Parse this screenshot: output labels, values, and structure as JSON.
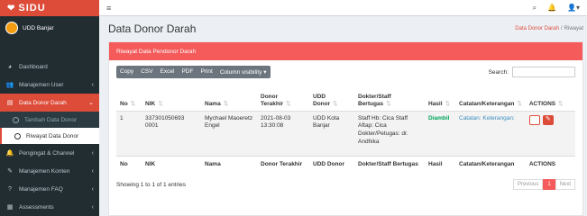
{
  "app": {
    "logo": "SIDU"
  },
  "user": {
    "name": "UDD Banjar"
  },
  "sidebar": {
    "items": [
      {
        "label": "Dashboard",
        "icon": "dashboard-icon"
      },
      {
        "label": "Manajemen User",
        "icon": "users-icon"
      },
      {
        "label": "Data Donor Darah",
        "icon": "list-icon"
      },
      {
        "label": "Tambah Data Donor"
      },
      {
        "label": "Riwayat Data Donor"
      },
      {
        "label": "Pengingat & Channel",
        "icon": "bell-icon"
      },
      {
        "label": "Manajemen Konten",
        "icon": "edit-icon"
      },
      {
        "label": "Manajemen FAQ",
        "icon": "question-icon"
      },
      {
        "label": "Assessments",
        "icon": "clipboard-icon"
      }
    ]
  },
  "page": {
    "title": "Data Donor Darah",
    "breadcrumb": {
      "parent": "Data Donor Darah",
      "current": "Riwayat"
    }
  },
  "box": {
    "title": "Riwayat Data Pendonor Darah"
  },
  "toolbar": {
    "buttons": [
      "Copy",
      "CSV",
      "Excel",
      "PDF",
      "Print",
      "Column visibility ▾"
    ],
    "search_label": "Search:"
  },
  "table": {
    "headers": [
      "No",
      "NIK",
      "Nama",
      "Donor Terakhir",
      "UDD Donor",
      "Dokter/Staff Bertugas",
      "Hasil",
      "Catatan/Keterangan",
      "ACTIONS"
    ],
    "rows": [
      {
        "no": "1",
        "nik": "337301050693 0001",
        "nama": "Mychael Maoeretz Engel",
        "donor_terakhir": "2021-08-03 13:30:08",
        "udd_donor": "UDD Kota Banjar",
        "dokter": "Staff Hb: Cica Staff Aftap: Cica Dokter/Petugas: dr. Andhika",
        "hasil": "Diambil",
        "catatan": "Catatan: Keterangan:"
      }
    ],
    "footers": [
      "No",
      "NIK",
      "Nama",
      "Donor Terakhir",
      "UDD Donor",
      "Dokter/Staff Bertugas",
      "Hasil",
      "Catatan/Keterangan",
      "ACTIONS"
    ]
  },
  "footer": {
    "info": "Showing 1 to 1 of 1 entries",
    "previous": "Previous",
    "page": "1",
    "next": "Next"
  }
}
